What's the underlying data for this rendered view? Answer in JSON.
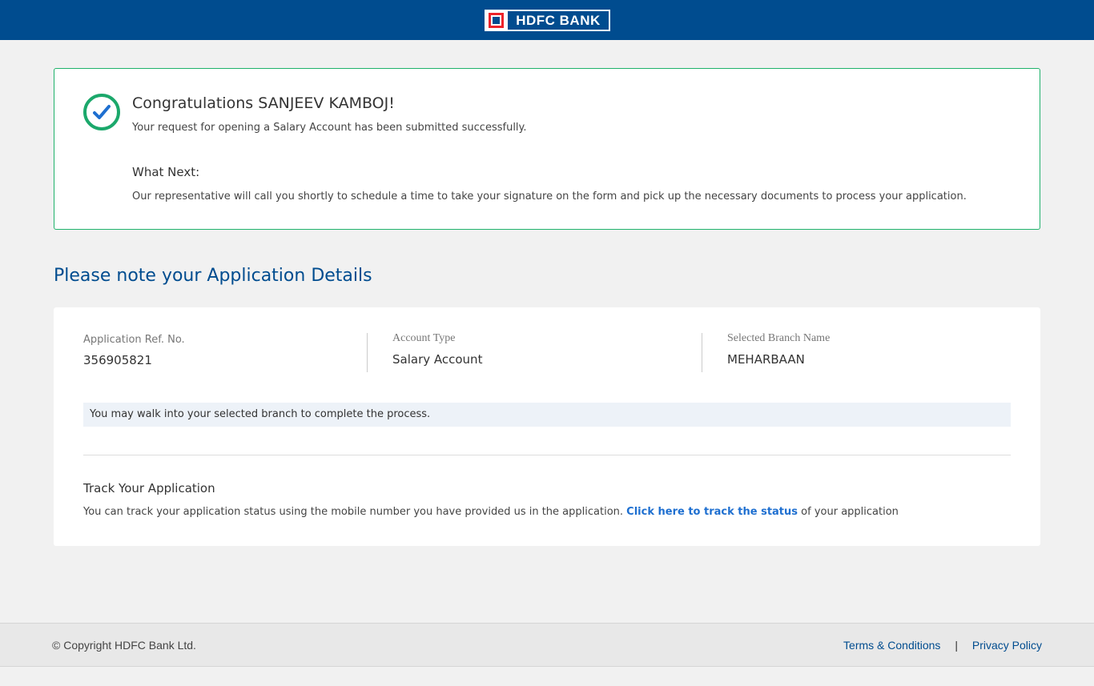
{
  "header": {
    "brand": "HDFC BANK",
    "brand_color": "#004c8f",
    "accent_red": "#ed232a"
  },
  "success": {
    "icon": "check-circle-icon",
    "congrats": "Congratulations SANJEEV KAMBOJ!",
    "message": "Your request for opening a Salary Account has been submitted successfully.",
    "next_title": "What Next:",
    "next_message": "Our representative will call you shortly to schedule a time to take your signature on the form and pick up the necessary documents to process your application."
  },
  "details": {
    "title": "Please note your Application Details",
    "ref_label": "Application Ref. No.",
    "ref_value": "356905821",
    "account_label": "Account Type",
    "account_value": "Salary Account",
    "branch_label": "Selected Branch Name",
    "branch_value": "MEHARBAAN",
    "walk_note": "You may walk into your selected branch to complete the process.",
    "track_title": "Track Your Application",
    "track_prefix": "You can track your application status using the mobile number you have provided us in the application.",
    "track_link": "Click here to track the status",
    "track_suffix": "of your application"
  },
  "footer": {
    "copyright": "© Copyright HDFC Bank Ltd.",
    "terms": "Terms & Conditions",
    "separator": "|",
    "privacy": "Privacy Policy"
  }
}
